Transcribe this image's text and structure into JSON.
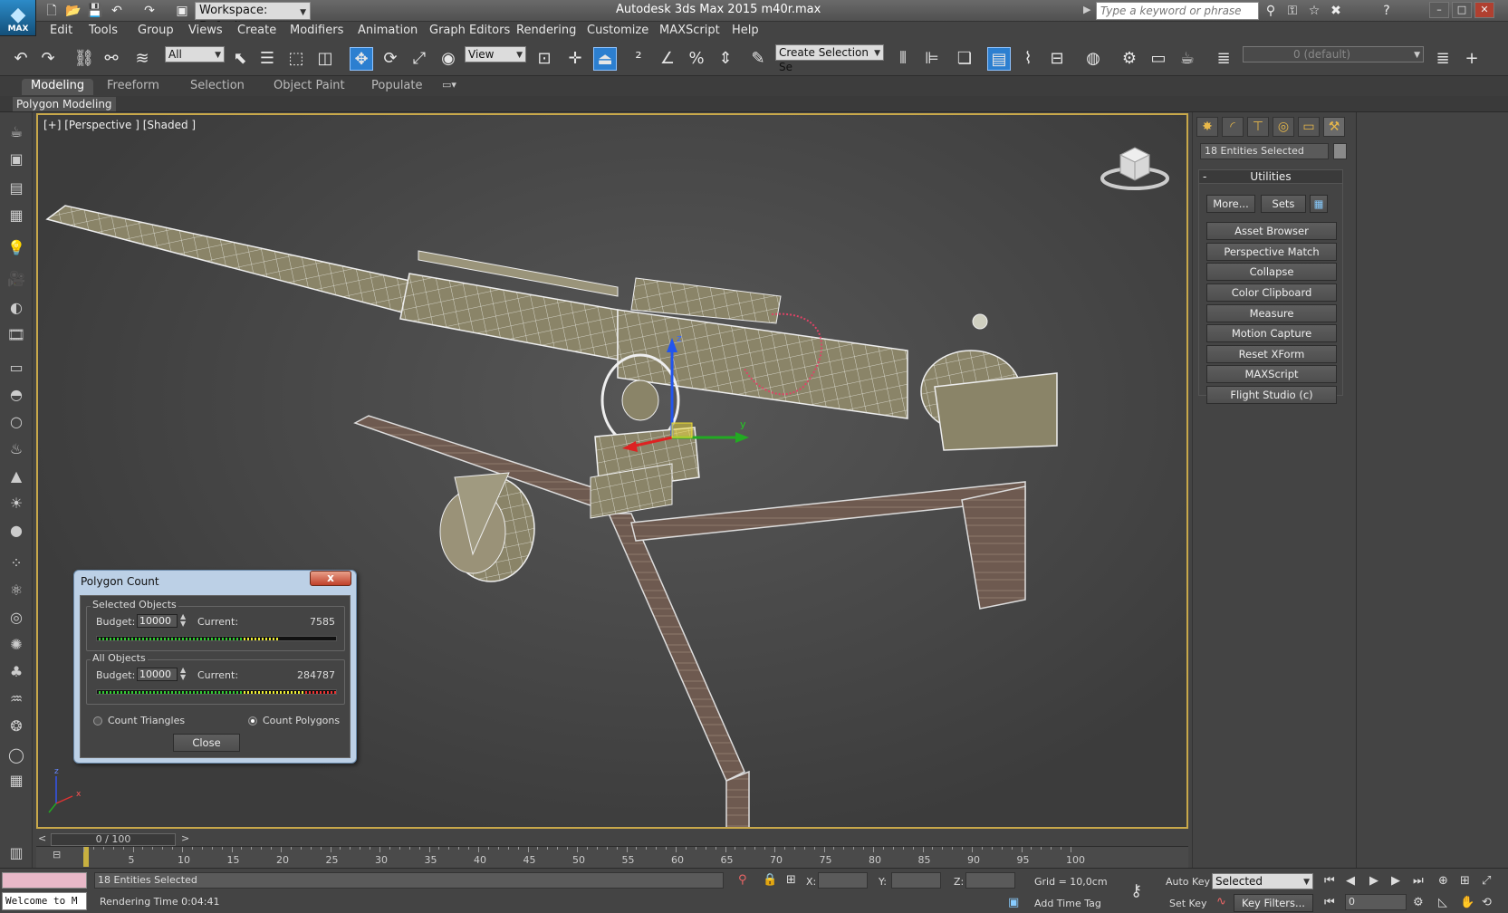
{
  "titlebar": {
    "logo_text": "MAX",
    "workspace": "Workspace: Default",
    "app_title": "Autodesk 3ds Max  2015     m40r.max",
    "search_placeholder": "Type a keyword or phrase"
  },
  "menu": [
    "Edit",
    "Tools",
    "Group",
    "Views",
    "Create",
    "Modifiers",
    "Animation",
    "Graph Editors",
    "Rendering",
    "Customize",
    "MAXScript",
    "Help"
  ],
  "toolbar": {
    "filter": "All",
    "coord_system": "View",
    "selection_set": "Create Selection Se",
    "layer": "0 (default)"
  },
  "ribbon": {
    "tabs": [
      "Modeling",
      "Freeform",
      "Selection",
      "Object Paint",
      "Populate"
    ],
    "active_tab": "Modeling",
    "panel": "Polygon Modeling"
  },
  "viewport": {
    "label": "[+] [Perspective ] [Shaded ]",
    "axis_x": "x",
    "axis_y": "y",
    "axis_z": "z"
  },
  "command_panel": {
    "selection_info": "18 Entities Selected",
    "rollout_title": "Utilities",
    "rollout_collapse": "-",
    "more_button": "More...",
    "sets_button": "Sets",
    "utilities": [
      "Asset Browser",
      "Perspective Match",
      "Collapse",
      "Color Clipboard",
      "Measure",
      "Motion Capture",
      "Reset XForm",
      "MAXScript",
      "Flight Studio (c)"
    ]
  },
  "polygon_count": {
    "title": "Polygon Count",
    "close_x": "x",
    "selected_group": "Selected Objects",
    "all_group": "All Objects",
    "budget_label": "Budget:",
    "current_label": "Current:",
    "selected_budget": "10000",
    "selected_current": "7585",
    "all_budget": "10000",
    "all_current": "284787",
    "count_triangles": "Count Triangles",
    "count_polygons": "Count Polygons",
    "mode": "polygons",
    "close_button": "Close",
    "selected_ratio": 0.7585,
    "all_ratio": 1.0
  },
  "timeline": {
    "slider": "0 / 100",
    "ticks": [
      "5",
      "10",
      "15",
      "20",
      "25",
      "30",
      "35",
      "40",
      "45",
      "50",
      "55",
      "60",
      "65",
      "70",
      "75",
      "80",
      "85",
      "90",
      "95",
      "100"
    ]
  },
  "status": {
    "welcome": "Welcome to M",
    "selection": "18 Entities Selected",
    "render_time": "Rendering Time  0:04:41",
    "x_label": "X:",
    "y_label": "Y:",
    "z_label": "Z:",
    "grid": "Grid = 10,0cm",
    "add_time_tag": "Add Time Tag",
    "auto_key": "Auto Key",
    "set_key": "Set Key",
    "key_mode": "Selected",
    "key_filters": "Key Filters...",
    "frame": "0"
  },
  "colors": {
    "accent": "#2c7fd0",
    "viewport_border": "#c8a84a",
    "dialog": "#bcd0e6"
  }
}
